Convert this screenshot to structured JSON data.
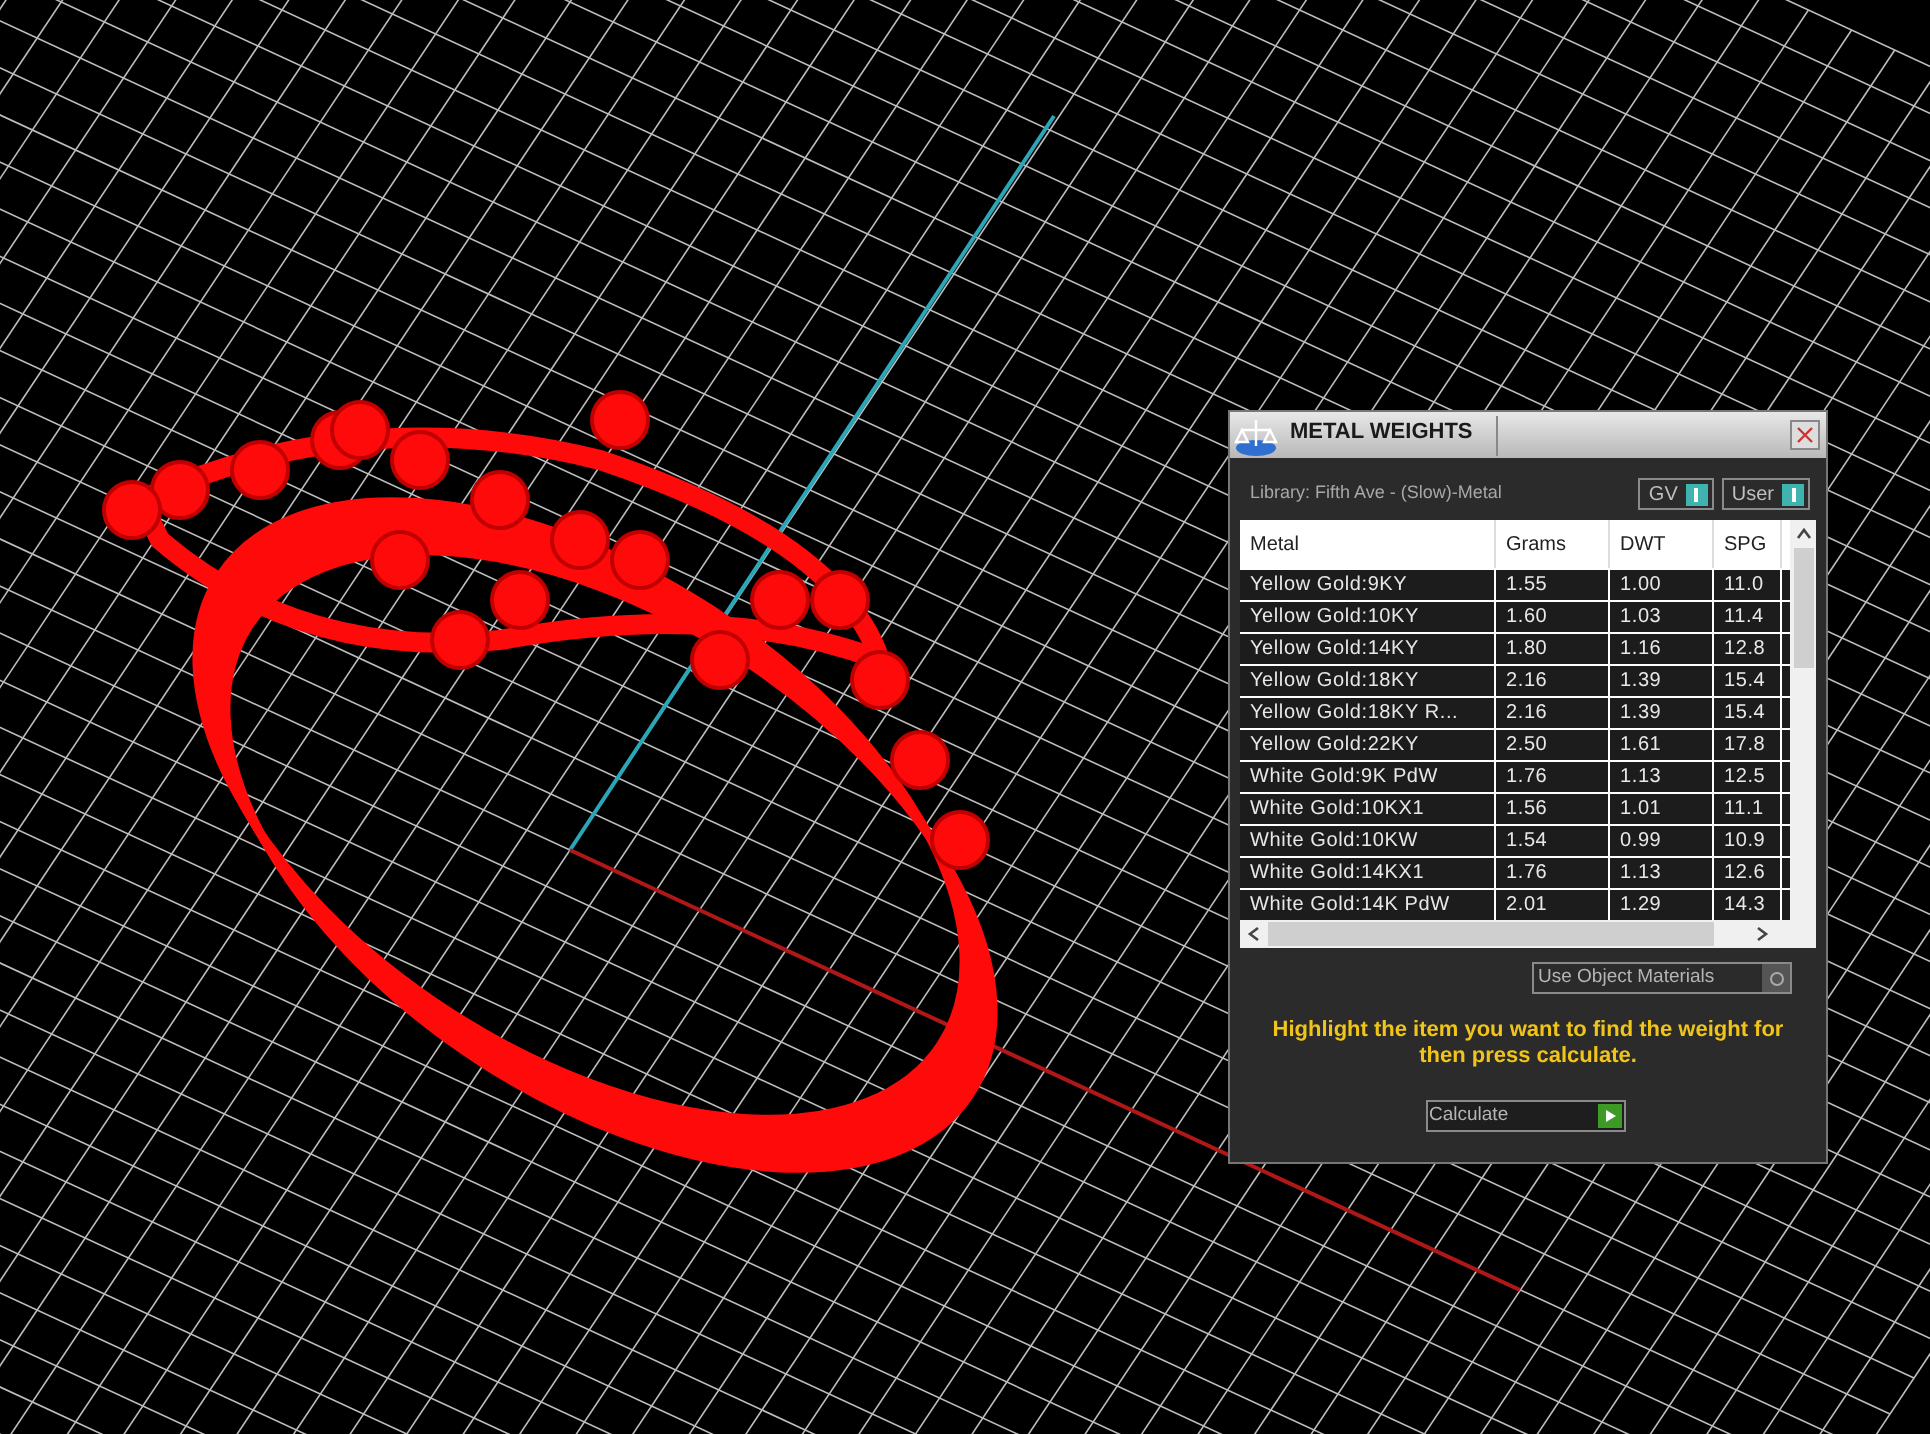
{
  "window": {
    "title": "METAL WEIGHTS"
  },
  "library": "Library: Fifth Ave - (Slow)-Metal",
  "toggles": [
    {
      "label": "GV",
      "on": true
    },
    {
      "label": "User",
      "on": true
    }
  ],
  "table": {
    "columns": [
      "Metal",
      "Grams",
      "DWT",
      "SPG"
    ],
    "rows": [
      [
        "Yellow Gold:9KY",
        "1.55",
        "1.00",
        "11.0"
      ],
      [
        "Yellow Gold:10KY",
        "1.60",
        "1.03",
        "11.4"
      ],
      [
        "Yellow Gold:14KY",
        "1.80",
        "1.16",
        "12.8"
      ],
      [
        "Yellow Gold:18KY",
        "2.16",
        "1.39",
        "15.4"
      ],
      [
        "Yellow Gold:18KY R...",
        "2.16",
        "1.39",
        "15.4"
      ],
      [
        "Yellow Gold:22KY",
        "2.50",
        "1.61",
        "17.8"
      ],
      [
        "White Gold:9K PdW",
        "1.76",
        "1.13",
        "12.5"
      ],
      [
        "White Gold:10KX1",
        "1.56",
        "1.01",
        "11.1"
      ],
      [
        "White Gold:10KW",
        "1.54",
        "0.99",
        "10.9"
      ],
      [
        "White Gold:14KX1",
        "1.76",
        "1.13",
        "12.6"
      ],
      [
        "White Gold:14K PdW",
        "2.01",
        "1.29",
        "14.3"
      ]
    ]
  },
  "use_object_materials": {
    "label": "Use Object Materials",
    "on": false
  },
  "instruction": "Highlight the item you want to find the weight for then press calculate.",
  "calculate_button": "Calculate"
}
